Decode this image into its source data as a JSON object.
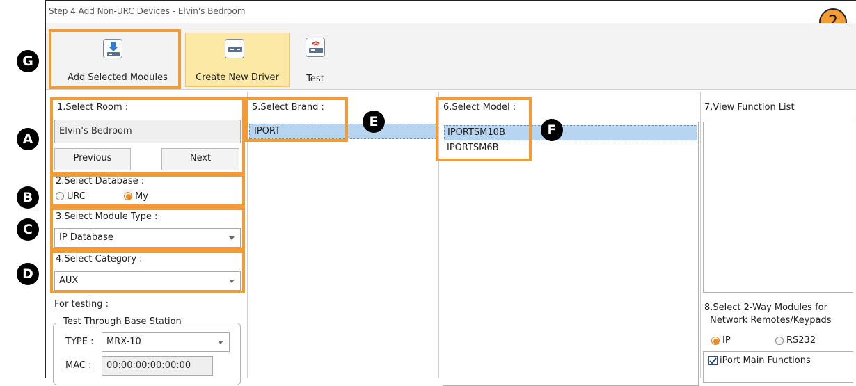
{
  "window": {
    "title": "Step 4 Add Non-URC Devices - Elvin's Bedroom",
    "step_badge": "2"
  },
  "toolbar": {
    "add_selected_modules": "Add Selected Modules",
    "create_new_driver": "Create New Driver",
    "test": "Test"
  },
  "room": {
    "title": "1.Select Room :",
    "value": "Elvin's Bedroom",
    "previous": "Previous",
    "next": "Next"
  },
  "database": {
    "title": "2.Select Database :",
    "options": [
      "URC",
      "My"
    ],
    "selected": "My"
  },
  "module_type": {
    "title": "3.Select Module Type :",
    "value": "IP Database"
  },
  "category": {
    "title": "4.Select Category :",
    "value": "AUX"
  },
  "testing": {
    "title": "For testing :",
    "group": "Test Through Base Station",
    "type_label": "TYPE :",
    "type_value": "MRX-10",
    "mac_label": "MAC :",
    "mac_value": "00:00:00:00:00:00"
  },
  "brand": {
    "title": "5.Select Brand :",
    "items": [
      "IPORT"
    ],
    "selected": "IPORT"
  },
  "model": {
    "title": "6.Select Model :",
    "items": [
      "IPORTSM10B",
      "IPORTSM6B"
    ],
    "selected": "IPORTSM10B"
  },
  "function_list": {
    "title": "7.View Function List"
  },
  "two_way": {
    "title_line1": "8.Select 2-Way Modules for",
    "title_line2": "Network Remotes/Keypads",
    "options": [
      "IP",
      "RS232"
    ],
    "selected": "IP",
    "items": [
      {
        "label": "iPort Main Functions",
        "checked": true
      }
    ]
  },
  "markers": {
    "a": "A",
    "b": "B",
    "c": "C",
    "d": "D",
    "e": "E",
    "f": "F",
    "g": "G"
  },
  "colors": {
    "annotation_orange": "#f39c34",
    "selection_blue": "#b7d4f0",
    "highlight_yellow": "#fde9a6"
  }
}
